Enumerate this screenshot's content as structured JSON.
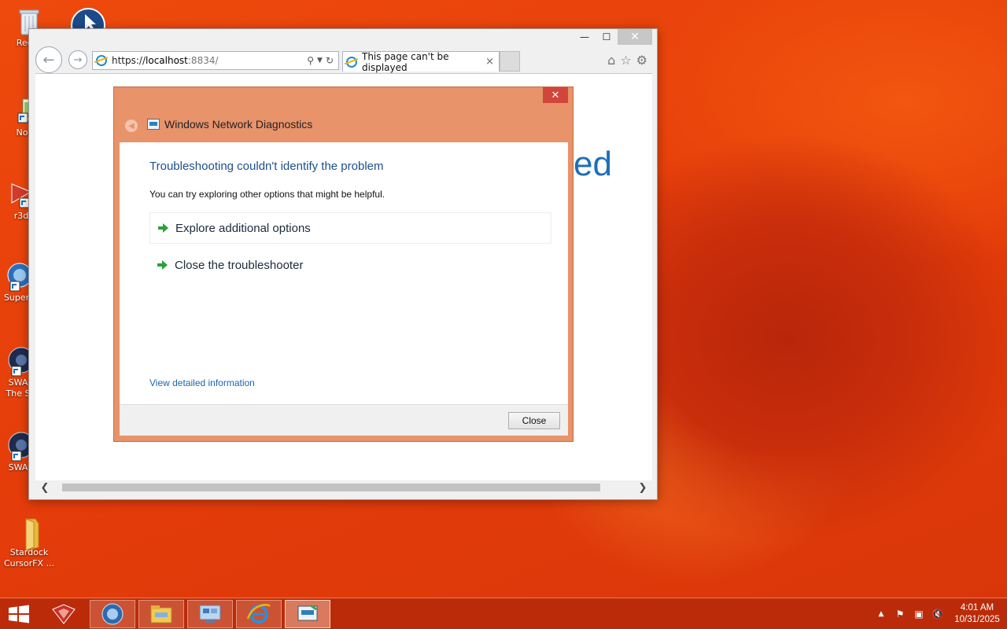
{
  "desktop": {
    "icons": [
      {
        "label": "Recyc"
      },
      {
        "label": "Notep"
      },
      {
        "label": "r3d"
      },
      {
        "label": "Super"
      },
      {
        "label": "SWA\nThe S"
      },
      {
        "label": "SWA"
      },
      {
        "label": "Stardock\nCursorFX ..."
      }
    ]
  },
  "browser": {
    "address": {
      "scheme": "https://",
      "host": "localhost",
      "rest": ":8834/"
    },
    "tab": {
      "title": "This page can't be displayed",
      "close_glyph": "×"
    },
    "page_heading_fragment": "ed",
    "window_controls": {
      "minimize": "—",
      "maximize": "☐",
      "close": "✕"
    }
  },
  "dialog": {
    "title": "Windows Network Diagnostics",
    "close_glyph": "✕",
    "heading": "Troubleshooting couldn't identify the problem",
    "description": "You can try exploring other options that might be helpful.",
    "options": [
      {
        "label": "Explore additional options"
      },
      {
        "label": "Close the troubleshooter"
      }
    ],
    "detail_link": "View detailed information",
    "close_button": "Close"
  },
  "taskbar": {
    "clock": {
      "time": "4:01 AM",
      "date": "10/31/2025"
    }
  },
  "colors": {
    "desktop_bg": "#e8410b",
    "dialog_frame": "#e8936a",
    "dialog_heading": "#1f4e8c",
    "link": "#1b65b0",
    "option_arrow": "#2aa33a"
  }
}
